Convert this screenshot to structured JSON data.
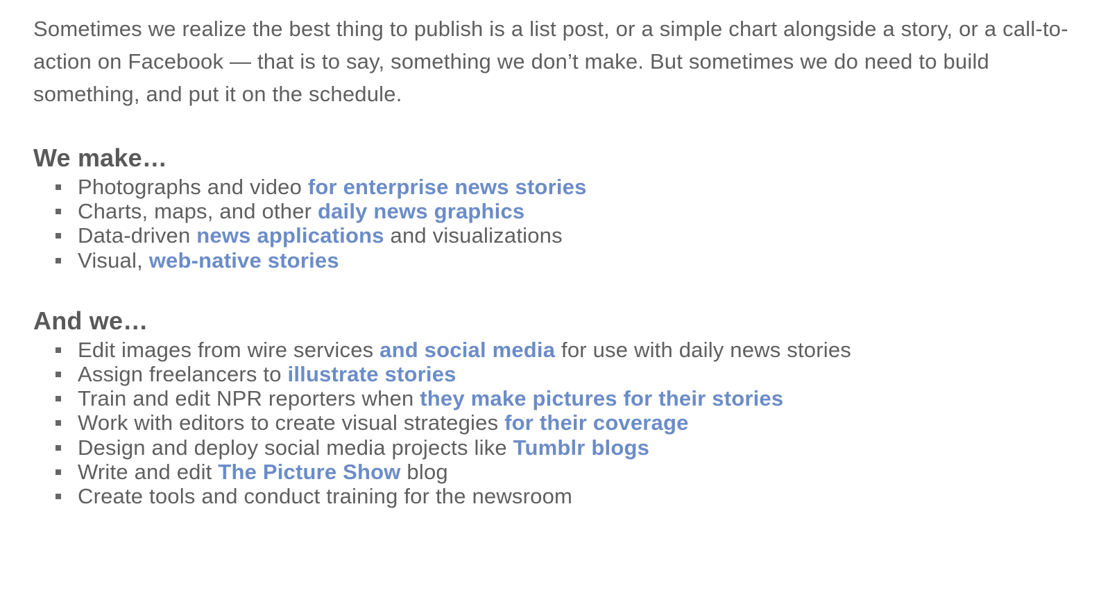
{
  "intro": "Sometimes we realize the best thing to publish is a list post, or a simple chart alongside a story, or a call-to-action on Facebook — that is to say, something we don’t make. But sometimes we do need to build something, and put it on the schedule.",
  "colors": {
    "text": "#5f5f5f",
    "heading": "#595959",
    "link": "#6b8cc8",
    "bullet": "#666666"
  },
  "bullet_icon": "square-bullet",
  "make": {
    "heading": "We make…",
    "items": [
      {
        "pre": "Photographs and video ",
        "link": "for enterprise news stories",
        "post": ""
      },
      {
        "pre": "Charts, maps, and other ",
        "link": "daily news graphics",
        "post": ""
      },
      {
        "pre": "Data-driven ",
        "link": "news applications",
        "post": " and visualizations"
      },
      {
        "pre": "Visual, ",
        "link": "web-native stories",
        "post": ""
      }
    ]
  },
  "and_we": {
    "heading": "And we…",
    "items": [
      {
        "pre": "Edit images from wire services ",
        "link": "and social media",
        "post": " for use with daily news stories"
      },
      {
        "pre": "Assign freelancers to ",
        "link": "illustrate stories",
        "post": ""
      },
      {
        "pre": "Train and edit NPR reporters when ",
        "link": "they make pictures for their stories",
        "post": ""
      },
      {
        "pre": "Work with editors to create visual strategies ",
        "link": "for their coverage",
        "post": ""
      },
      {
        "pre": "Design and deploy social media projects like ",
        "link": "Tumblr blogs",
        "post": ""
      },
      {
        "pre": "Write and edit ",
        "link": "The Picture Show",
        "post": " blog"
      },
      {
        "pre": "Create tools and conduct training for the newsroom",
        "link": "",
        "post": ""
      }
    ]
  }
}
